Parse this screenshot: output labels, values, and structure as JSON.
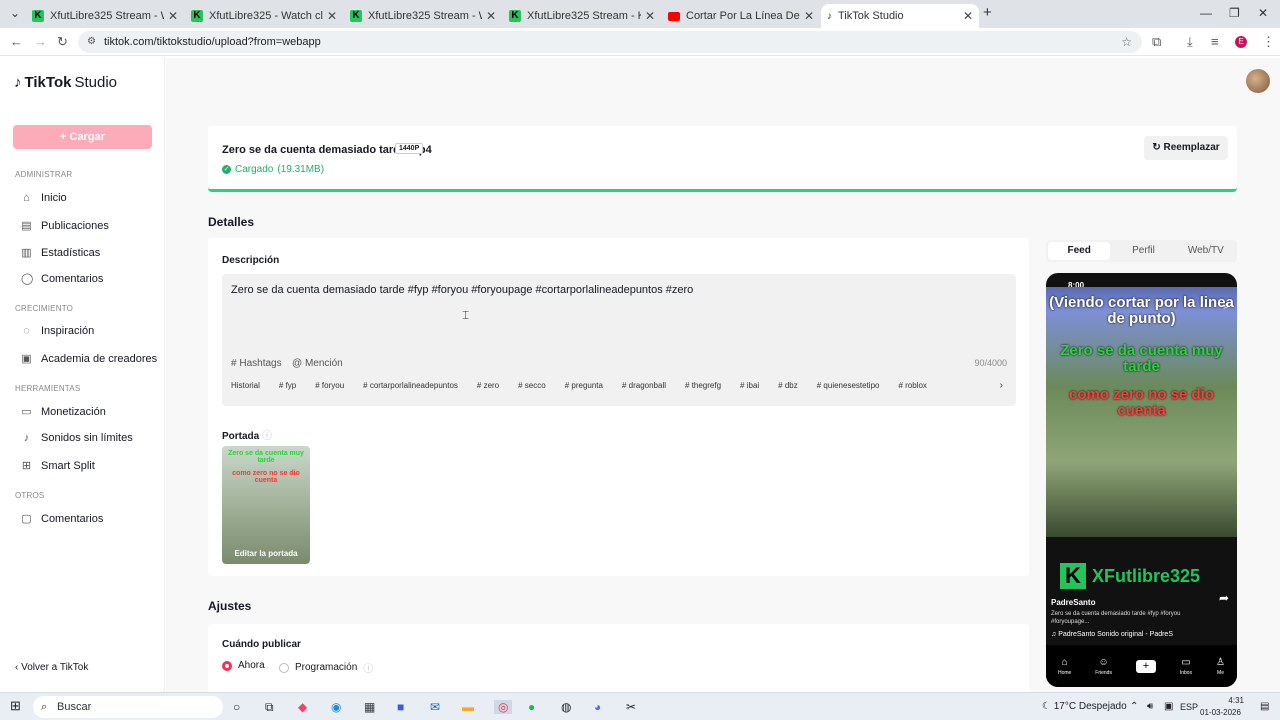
{
  "browser": {
    "tabs": [
      {
        "title": "XfutLibre325 Stream - Watch Li",
        "favicon": "kick"
      },
      {
        "title": "XfutLibre325 - Watch clips on K",
        "favicon": "kick"
      },
      {
        "title": "XfutLibre325 Stream - Watch Li",
        "favicon": "kick"
      },
      {
        "title": "XfutLibre325 Stream - Kick Das",
        "favicon": "kick"
      },
      {
        "title": "Cortar Por La Línea De Puntos -",
        "favicon": "youtube"
      },
      {
        "title": "TikTok Studio",
        "favicon": "tiktok",
        "active": true
      }
    ],
    "url": "tiktok.com/tiktokstudio/upload?from=webapp",
    "profile_initial": "E"
  },
  "sidebar": {
    "logo_brand": "TikTok",
    "logo_product": "Studio",
    "upload_label": "Cargar",
    "sections": {
      "admin": "ADMINISTRAR",
      "growth": "CRECIMIENTO",
      "tools": "HERRAMIENTAS",
      "others": "OTROS"
    },
    "items": {
      "inicio": "Inicio",
      "publicaciones": "Publicaciones",
      "estadisticas": "Estadísticas",
      "comentarios": "Comentarios",
      "inspiracion": "Inspiración",
      "academia": "Academia de creadores",
      "monetizacion": "Monetización",
      "sonidos": "Sonidos sin límites",
      "smart_split": "Smart Split",
      "comentarios2": "Comentarios"
    },
    "back_label": "Volver a TikTok"
  },
  "upload": {
    "filename": "Zero se da cuenta demasiado tarde.mp4",
    "quality_badge": "1440P",
    "status": "Cargado",
    "size": "(19.31MB)",
    "replace_label": "Reemplazar"
  },
  "details": {
    "heading": "Detalles",
    "description_label": "Descripción",
    "description_text": "Zero se da cuenta demasiado tarde  #fyp  #foryou  #foryoupage  #cortarporlalineadepuntos  #zero",
    "hashtags_label": "Hashtags",
    "mention_label": "Mención",
    "char_count": "90/4000",
    "suggestions": [
      "Historial",
      "# fyp",
      "# foryou",
      "# cortarporlalineadepuntos",
      "# zero",
      "# secco",
      "# pregunta",
      "# dragonball",
      "# thegrefg",
      "# ibai",
      "# dbz",
      "# quienesestetipo",
      "# roblox"
    ],
    "cover_label": "Portada",
    "cover_edit_label": "Editar la portada"
  },
  "settings": {
    "heading": "Ajustes",
    "when_label": "Cuándo publicar",
    "option_now": "Ahora",
    "option_schedule": "Programación"
  },
  "preview": {
    "tabs": [
      "Feed",
      "Perfil",
      "Web/TV"
    ],
    "active_tab": "Feed",
    "time": "8:00",
    "caption_top": "(Viendo cortar por la linea de punto)",
    "caption_green": "Zero se da cuenta muy tarde",
    "caption_red": "como zero no se dio cuenta",
    "watermark": "XFutlibre325",
    "handle": "PadreSanto",
    "video_caption": "Zero se da cuenta demasiado tarde #fyp #foryou #foryoupage...",
    "sound": "PadreSanto   Sonido original - PadreS",
    "nav": [
      "Home",
      "Friends",
      "",
      "Inbox",
      "Me"
    ]
  },
  "taskbar": {
    "search_placeholder": "Buscar",
    "weather": "17°C  Despejado",
    "lang": "ESP",
    "time": "4:31",
    "date": "01-03-2026"
  },
  "colors": {
    "brand": "#fe2c55",
    "upload_btn": "#fdaab9",
    "success": "#1fb06b",
    "kick": "#25c35c"
  }
}
